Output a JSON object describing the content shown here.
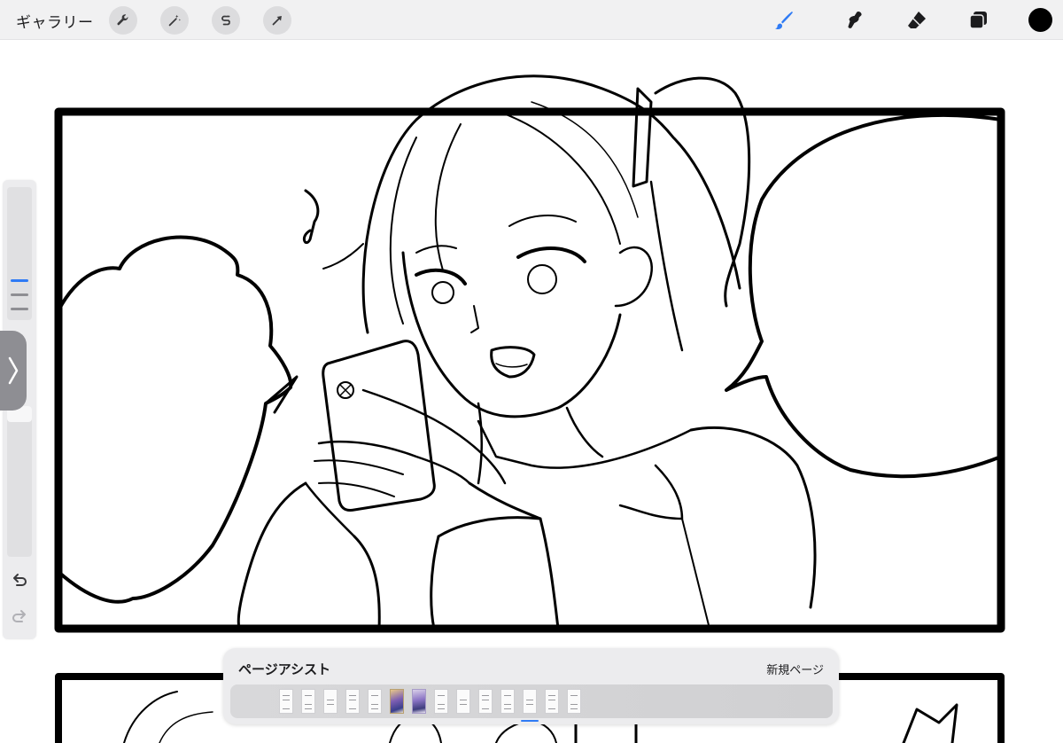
{
  "toolbar": {
    "gallery_label": "ギャラリー",
    "left_tools": [
      "wrench-icon",
      "magic-wand-icon",
      "selection-s-icon",
      "transform-arrow-icon"
    ],
    "right_tools": [
      "brush-icon",
      "smudge-icon",
      "eraser-icon",
      "layers-icon"
    ],
    "active_tool": "brush-icon",
    "active_tool_color": "#2f7bf5",
    "current_color": "#000000"
  },
  "sidebar": {
    "brush_size_slider": "brush-size-slider",
    "opacity_slider": "opacity-slider",
    "modify_button": "modify-square-icon",
    "undo": "undo-icon",
    "redo": "redo-icon",
    "collapse": "chevron-right-icon"
  },
  "page_assist": {
    "title": "ページアシスト",
    "new_page_label": "新規ページ",
    "thumbnail_count": 14,
    "selected_index": 11
  }
}
